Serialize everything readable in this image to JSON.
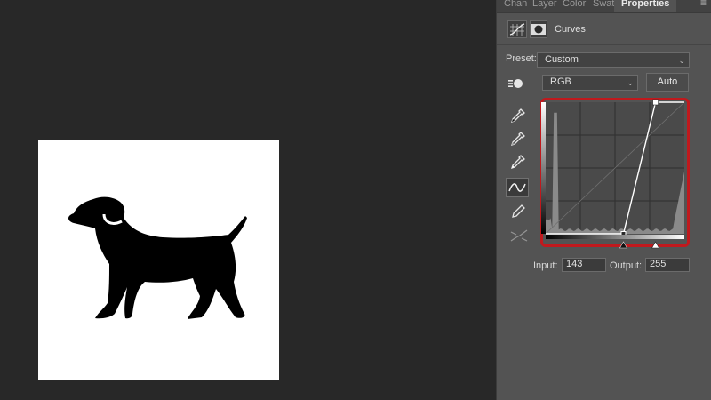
{
  "panel_tabs": [
    {
      "label": "Chan"
    },
    {
      "label": "Layer"
    },
    {
      "label": "Color"
    },
    {
      "label": "Swat"
    },
    {
      "label": "Properties"
    }
  ],
  "properties": {
    "title": "Curves",
    "preset_label": "Preset:",
    "preset_value": "Custom",
    "channel_value": "RGB",
    "auto_label": "Auto",
    "input_label": "Input:",
    "input_value": "143",
    "output_label": "Output:",
    "output_value": "255"
  },
  "curve": {
    "points": [
      [
        143,
        0
      ],
      [
        202,
        255
      ]
    ],
    "selected_input": 143,
    "selected_output": 255
  },
  "colors": {
    "highlight_frame": "#c0191d",
    "panel_bg": "#535353",
    "workspace_bg": "#282828"
  },
  "icons": {
    "menu": "hamburger-menu-icon",
    "adjustment": "curves-adjustment-icon",
    "mask": "layer-mask-icon",
    "hand": "targeted-adjustment-icon",
    "eyedropper_black": "black-point-eyedropper-icon",
    "eyedropper_gray": "gray-point-eyedropper-icon",
    "eyedropper_white": "white-point-eyedropper-icon",
    "curve_tool": "curve-point-tool-icon",
    "pencil": "pencil-draw-icon",
    "smooth": "smooth-curve-icon"
  }
}
